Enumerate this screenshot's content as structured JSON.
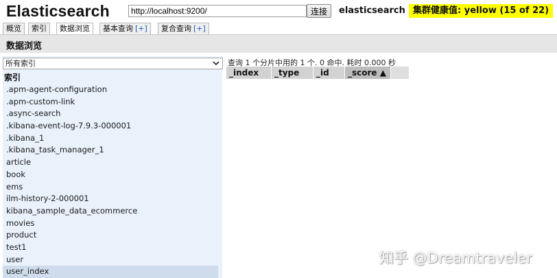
{
  "app": {
    "title": "Elasticsearch"
  },
  "connection": {
    "url": "http://localhost:9200/",
    "connect_label": "连接"
  },
  "cluster": {
    "name": "elasticsearch",
    "health": "集群健康值: yellow (15 of 22)",
    "health_color": "#ffff00"
  },
  "tabs": [
    {
      "label": "概览",
      "plus": ""
    },
    {
      "label": "索引",
      "plus": ""
    },
    {
      "label": "数据浏览",
      "plus": ""
    },
    {
      "label": "基本查询",
      "plus": "[+]"
    },
    {
      "label": "复合查询",
      "plus": "[+]"
    }
  ],
  "active_tab": "数据浏览",
  "page": {
    "title": "数据浏览"
  },
  "sidebar": {
    "select_value": "所有索引",
    "heading": "索引",
    "indices": [
      ".apm-agent-configuration",
      ".apm-custom-link",
      ".async-search",
      ".kibana-event-log-7.9.3-000001",
      ".kibana_1",
      ".kibana_task_manager_1",
      "article",
      "book",
      "ems",
      "ilm-history-2-000001",
      "kibana_sample_data_ecommerce",
      "movies",
      "product",
      "test1",
      "user",
      "user_index"
    ],
    "selected_index": "user_index"
  },
  "results": {
    "status": "查询 1 个分片中用的 1 个. 0 命中. 耗时 0.000 秒",
    "columns": [
      "_index",
      "_type",
      "_id",
      "_score ▲"
    ],
    "sorted_column": "_score ▲"
  },
  "watermark": "知乎 @Dreamtraveler"
}
